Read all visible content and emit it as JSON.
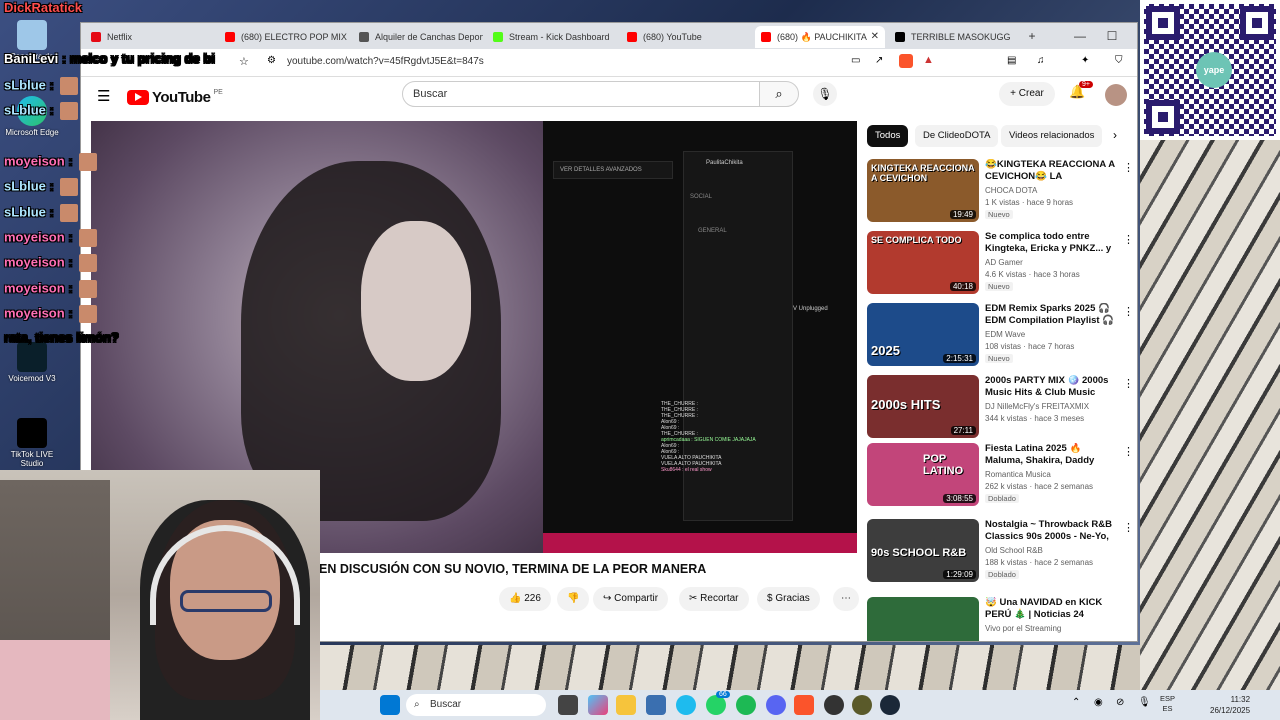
{
  "chat_overlay": {
    "top_line": "DickRatatick",
    "lines": [
      {
        "user": "BaniLevi",
        "text": ": melco y tu pricing de bi",
        "color": "#ffffff"
      },
      {
        "user": "sLblue",
        "text": ":",
        "color": "#aee6ff"
      },
      {
        "user": "sLblue",
        "text": ":",
        "color": "#aee6ff"
      },
      {
        "user": "moyeison",
        "text": ":",
        "color": "#ff6fb5"
      },
      {
        "user": "sLblue",
        "text": ":",
        "color": "#aee6ff"
      },
      {
        "user": "sLblue",
        "text": ":",
        "color": "#aee6ff"
      },
      {
        "user": "moyeison",
        "text": ":",
        "color": "#ff6fb5"
      },
      {
        "user": "moyeison",
        "text": ":",
        "color": "#ff6fb5"
      },
      {
        "user": "moyeison",
        "text": ":",
        "color": "#ff6fb5"
      },
      {
        "user": "moyeison",
        "text": ":",
        "color": "#ff6fb5"
      },
      {
        "user": "",
        "text": "rata, tienes limón?",
        "color": "#ffffff"
      }
    ]
  },
  "desktop_icons": [
    {
      "label": "Papelera de"
    },
    {
      "label": "Microsoft Edge"
    },
    {
      "label": "Voicemod V3"
    },
    {
      "label": "TikTok LIVE Studio"
    }
  ],
  "browser": {
    "tabs": [
      {
        "label": "Netflix",
        "color": "#e50914"
      },
      {
        "label": "(680) ELECTRO POP MIX 200",
        "color": "#ff0000"
      },
      {
        "label": "Alquiler de Canchas Deport",
        "color": "#555555"
      },
      {
        "label": "Stream - Kick Dashboard",
        "color": "#53fc18"
      },
      {
        "label": "(680) YouTube",
        "color": "#ff0000"
      },
      {
        "label": "(680) 🔥 PAUCHIKITA",
        "color": "#ff0000"
      },
      {
        "label": "TERRIBLE MASOKUGG",
        "color": "#000000"
      }
    ],
    "url": "youtube.com/watch?v=45fRgdvtJ5E&t=847s"
  },
  "youtube": {
    "logo_text": "YouTube",
    "country": "PE",
    "search_placeholder": "Buscar",
    "create_label": "Crear",
    "notif_count": "9+",
    "video_title": "EN DISCUSIÓN CON SU NOVIO, TERMINA DE LA PEOR MANERA",
    "likes": "226",
    "share_label": "Compartir",
    "clip_label": "Recortar",
    "thanks_label": "Gracias",
    "chips": [
      "Todos",
      "De ClideoDOTA",
      "Videos relacionados"
    ],
    "video_overlay": {
      "details_button": "VER DETALLES AVANZADOS",
      "streamer": "PaulitaChikita",
      "social": "SOCIAL",
      "general": "GENERAL",
      "unplugged": "V Unplugged",
      "chat": [
        "THE_CHURRE :",
        "THE_CHURRE :",
        "THE_CHURRE :",
        "Alon69 :",
        "Alon69 :",
        "THE_CHURRE :",
        "aprimcadaaa : SIGUEN COMIE JAJAJAJA",
        "Alon69 :",
        "Alon69 :",
        "VUELA ALTO PAUCHIKITA",
        "VUELA ALTO PAUCHIKITA",
        "Sku8644 : el real show"
      ]
    },
    "recommendations": [
      {
        "thumb_text": "KINGTEKA REACCIONA A CEVICHON",
        "duration": "19:49",
        "title": "😂KINGTEKA REACCIONA A CEVICHON😂 LA DECADENCI...",
        "channel": "CHOCA DOTA",
        "meta": "1 K vistas · hace 9 horas",
        "badge": "Nuevo",
        "color": "#8b5a2b"
      },
      {
        "thumb_text": "SE COMPLICA TODO",
        "duration": "40:18",
        "title": "Se complica todo entre Kingteka, Ericka y PNKZ... y ...",
        "channel": "AD Gamer",
        "meta": "4.6 K vistas · hace 3 horas",
        "badge": "Nuevo",
        "color": "#b23a2e"
      },
      {
        "thumb_text": "2025",
        "duration": "2:15:31",
        "title": "EDM Remix Sparks 2025 🎧 EDM Compilation Playlist 🎧 ...",
        "channel": "EDM Wave",
        "meta": "108 vistas · hace 7 horas",
        "badge": "Nuevo",
        "color": "#1d4b8a"
      },
      {
        "thumb_text": "2000s HITS",
        "duration": "27:11",
        "title": "2000s PARTY MIX 🪩 2000s Music Hits & Club Music Mixe...",
        "channel": "DJ NilleMcFly's FREITAXMIX",
        "meta": "344 k vistas · hace 3 meses",
        "badge": "",
        "color": "#7a2e2e"
      },
      {
        "thumb_text": "POP LATINO",
        "duration": "3:08:55",
        "title": "Fiesta Latina 2025 🔥 Maluma, Shakira, Daddy Yankee, Wisin, ...",
        "channel": "Romantica Musica",
        "meta": "262 k vistas · hace 2 semanas",
        "badge": "Doblado",
        "color": "#c2457a"
      },
      {
        "thumb_text": "90s SCHOOL R&B",
        "duration": "1:29:09",
        "title": "Nostalgia ~ Throwback R&B Classics 90s 2000s - Ne-Yo, ...",
        "channel": "Old School R&B",
        "meta": "188 k vistas · hace 2 semanas",
        "badge": "Doblado",
        "color": "#3d3d3d"
      },
      {
        "thumb_text": "",
        "duration": "",
        "title": "🤯 Una NAVIDAD en KICK PERÚ 🎄 | Noticias 24 diciembre",
        "channel": "Vivo por el Streaming",
        "meta": "",
        "badge": "",
        "color": "#2e6b3a"
      }
    ]
  },
  "qr": {
    "logo": "yape"
  },
  "taskbar": {
    "search_placeholder": "Buscar",
    "whatsapp_badge": "66",
    "lang_top": "ESP",
    "lang_bottom": "ES",
    "time": "11:32",
    "date": "26/12/2025"
  }
}
